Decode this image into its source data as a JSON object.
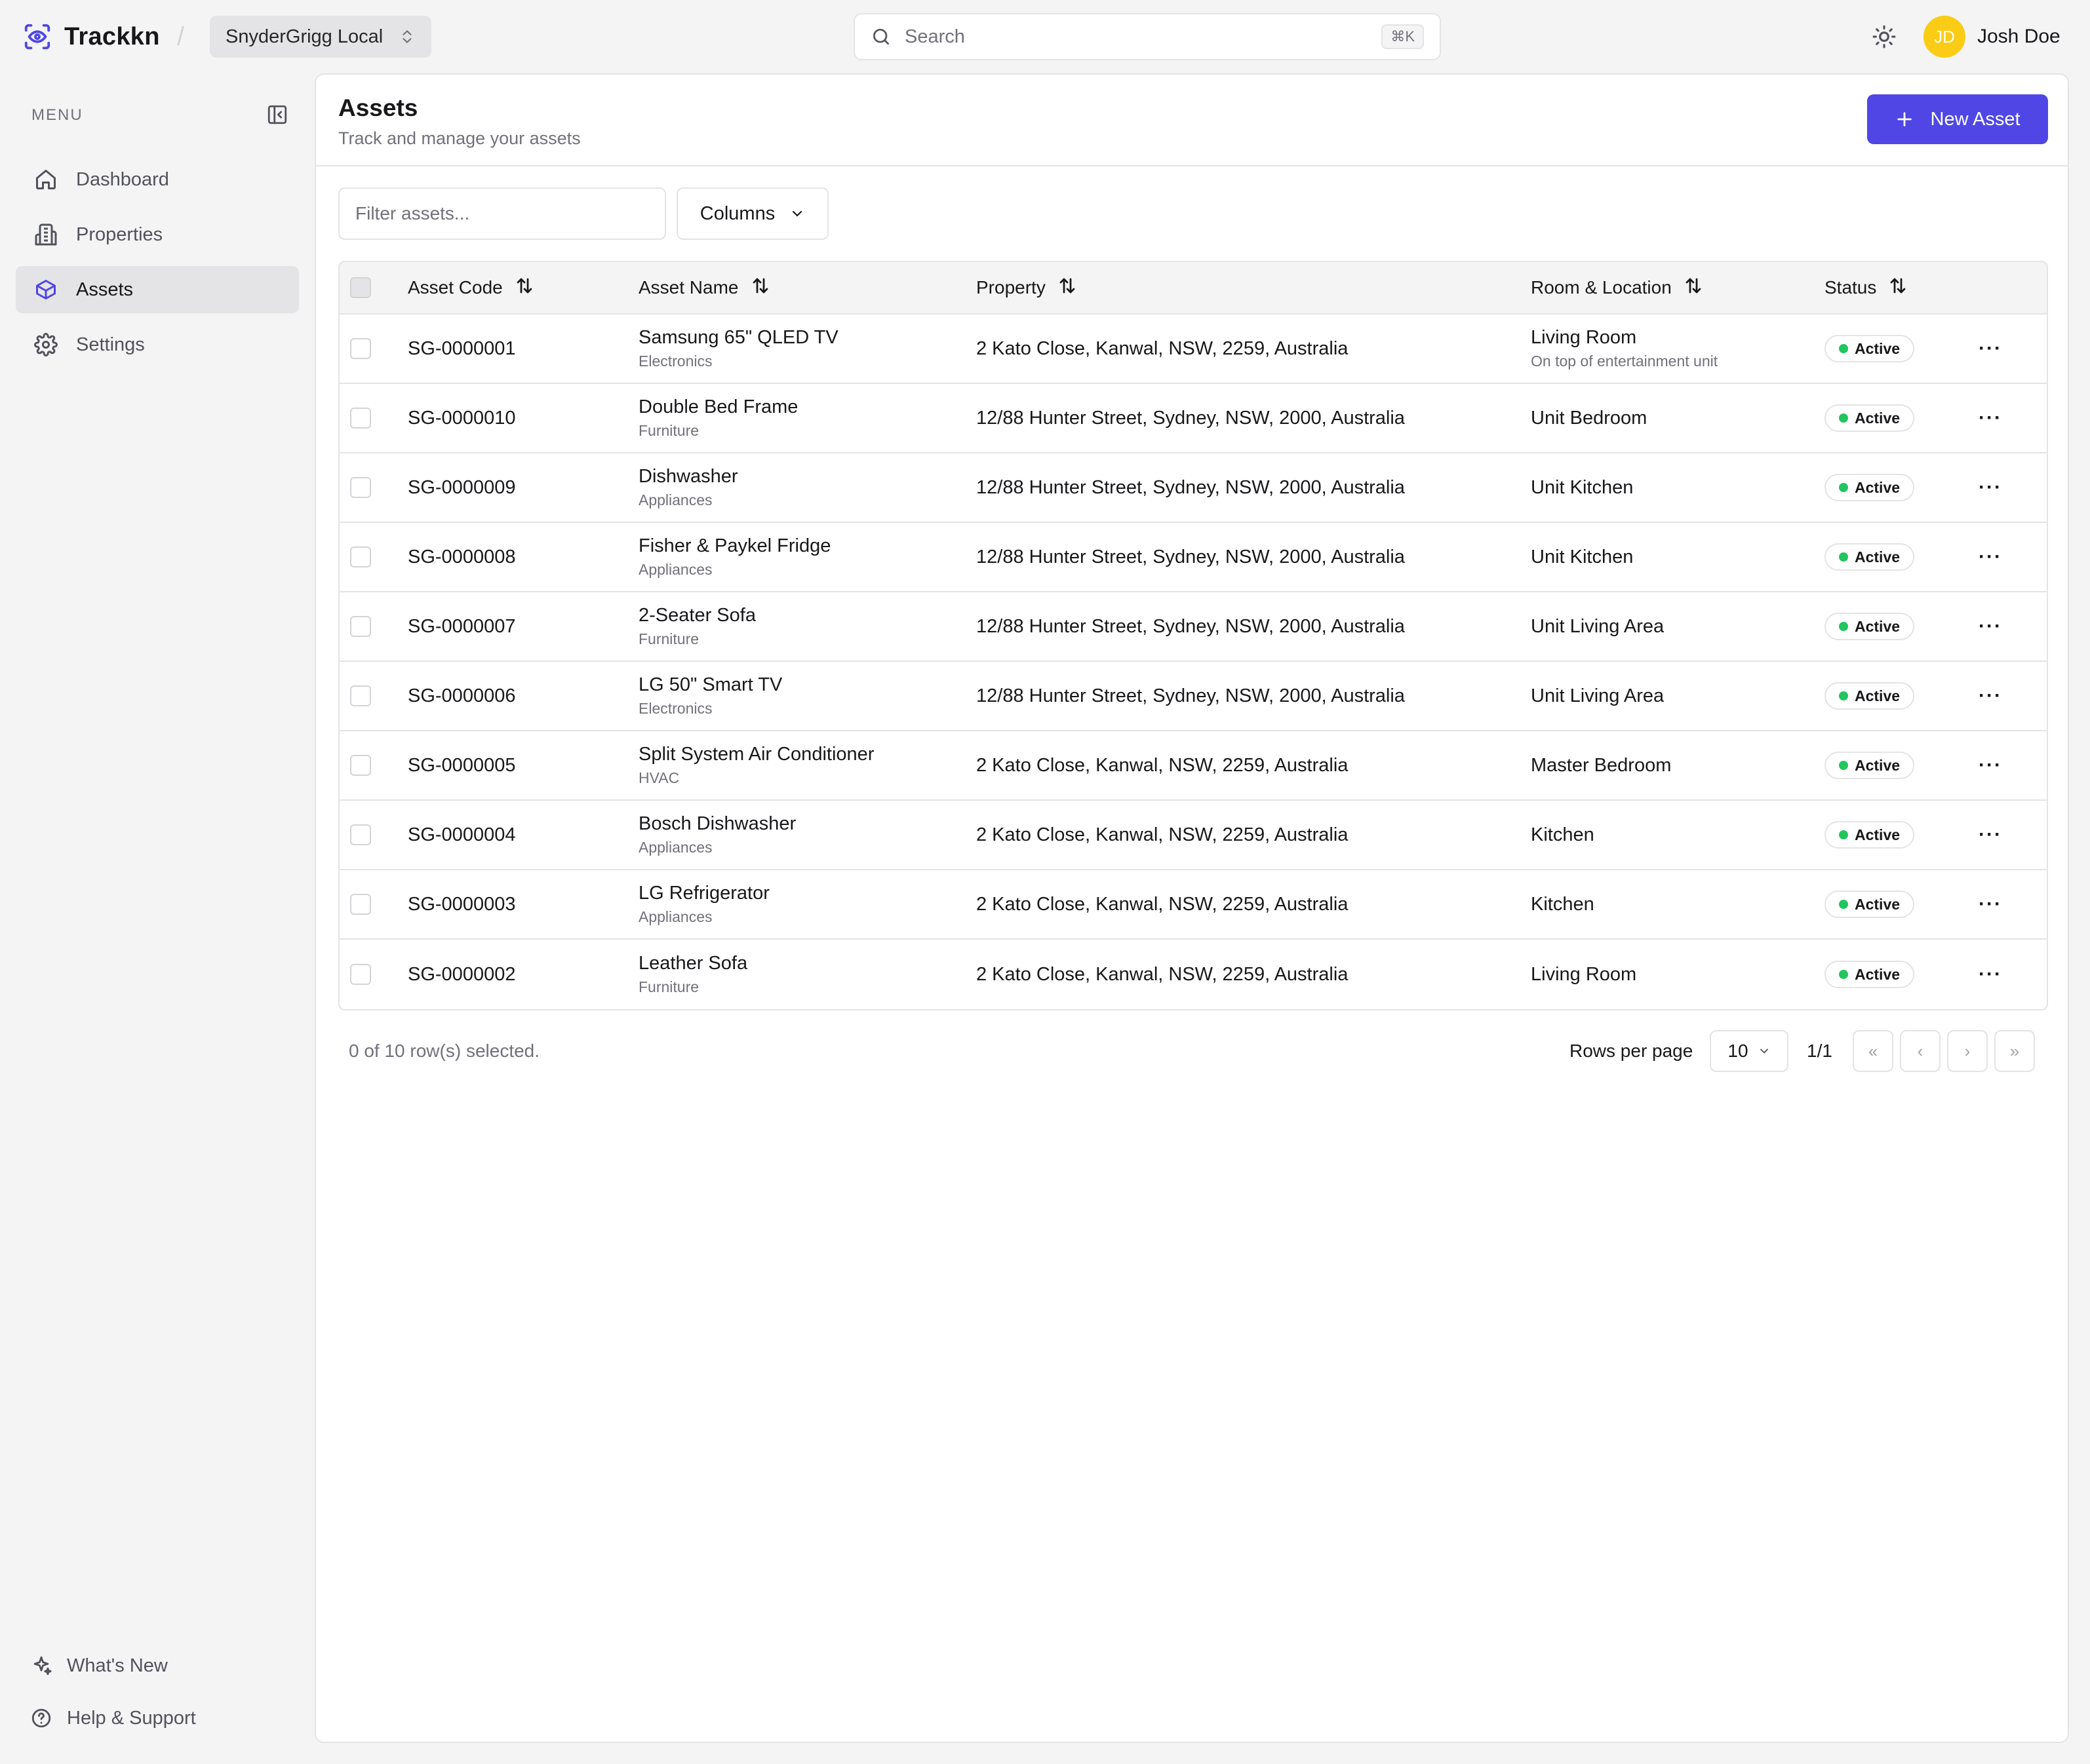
{
  "app": {
    "name": "Trackkn",
    "org": "SnyderGrigg Local"
  },
  "search": {
    "placeholder": "Search",
    "shortcut": "⌘K"
  },
  "user": {
    "initials": "JD",
    "name": "Josh Doe"
  },
  "sidebar": {
    "menu_label": "MENU",
    "items": [
      {
        "label": "Dashboard",
        "icon": "home-icon",
        "active": false
      },
      {
        "label": "Properties",
        "icon": "building-icon",
        "active": false
      },
      {
        "label": "Assets",
        "icon": "box-icon",
        "active": true
      },
      {
        "label": "Settings",
        "icon": "gear-icon",
        "active": false
      }
    ],
    "bottom": [
      {
        "label": "What's New",
        "icon": "sparkles-icon"
      },
      {
        "label": "Help & Support",
        "icon": "help-icon"
      }
    ]
  },
  "page": {
    "title": "Assets",
    "subtitle": "Track and manage your assets",
    "new_button": "New Asset",
    "filter_placeholder": "Filter assets...",
    "columns_button": "Columns"
  },
  "table": {
    "headers": {
      "code": "Asset Code",
      "name": "Asset Name",
      "property": "Property",
      "room": "Room & Location",
      "status": "Status"
    },
    "rows": [
      {
        "code": "SG-0000001",
        "name": "Samsung 65\" QLED TV",
        "category": "Electronics",
        "property": "2 Kato Close, Kanwal, NSW, 2259, Australia",
        "room": "Living Room",
        "location": "On top of entertainment unit",
        "status": "Active"
      },
      {
        "code": "SG-0000010",
        "name": "Double Bed Frame",
        "category": "Furniture",
        "property": "12/88 Hunter Street, Sydney, NSW, 2000, Australia",
        "room": "Unit Bedroom",
        "location": "",
        "status": "Active"
      },
      {
        "code": "SG-0000009",
        "name": "Dishwasher",
        "category": "Appliances",
        "property": "12/88 Hunter Street, Sydney, NSW, 2000, Australia",
        "room": "Unit Kitchen",
        "location": "",
        "status": "Active"
      },
      {
        "code": "SG-0000008",
        "name": "Fisher & Paykel Fridge",
        "category": "Appliances",
        "property": "12/88 Hunter Street, Sydney, NSW, 2000, Australia",
        "room": "Unit Kitchen",
        "location": "",
        "status": "Active"
      },
      {
        "code": "SG-0000007",
        "name": "2-Seater Sofa",
        "category": "Furniture",
        "property": "12/88 Hunter Street, Sydney, NSW, 2000, Australia",
        "room": "Unit Living Area",
        "location": "",
        "status": "Active"
      },
      {
        "code": "SG-0000006",
        "name": "LG 50\" Smart TV",
        "category": "Electronics",
        "property": "12/88 Hunter Street, Sydney, NSW, 2000, Australia",
        "room": "Unit Living Area",
        "location": "",
        "status": "Active"
      },
      {
        "code": "SG-0000005",
        "name": "Split System Air Conditioner",
        "category": "HVAC",
        "property": "2 Kato Close, Kanwal, NSW, 2259, Australia",
        "room": "Master Bedroom",
        "location": "",
        "status": "Active"
      },
      {
        "code": "SG-0000004",
        "name": "Bosch Dishwasher",
        "category": "Appliances",
        "property": "2 Kato Close, Kanwal, NSW, 2259, Australia",
        "room": "Kitchen",
        "location": "",
        "status": "Active"
      },
      {
        "code": "SG-0000003",
        "name": "LG Refrigerator",
        "category": "Appliances",
        "property": "2 Kato Close, Kanwal, NSW, 2259, Australia",
        "room": "Kitchen",
        "location": "",
        "status": "Active"
      },
      {
        "code": "SG-0000002",
        "name": "Leather Sofa",
        "category": "Furniture",
        "property": "2 Kato Close, Kanwal, NSW, 2259, Australia",
        "room": "Living Room",
        "location": "",
        "status": "Active"
      }
    ]
  },
  "footer": {
    "selected": "0 of 10 row(s) selected.",
    "rows_per_page_label": "Rows per page",
    "rows_per_page": "10",
    "page_info": "1/1",
    "first": "«",
    "prev": "‹",
    "next": "›",
    "last": "»"
  },
  "colors": {
    "accent": "#4f46e5",
    "status_active": "#22c55e",
    "avatar": "#facc15"
  }
}
